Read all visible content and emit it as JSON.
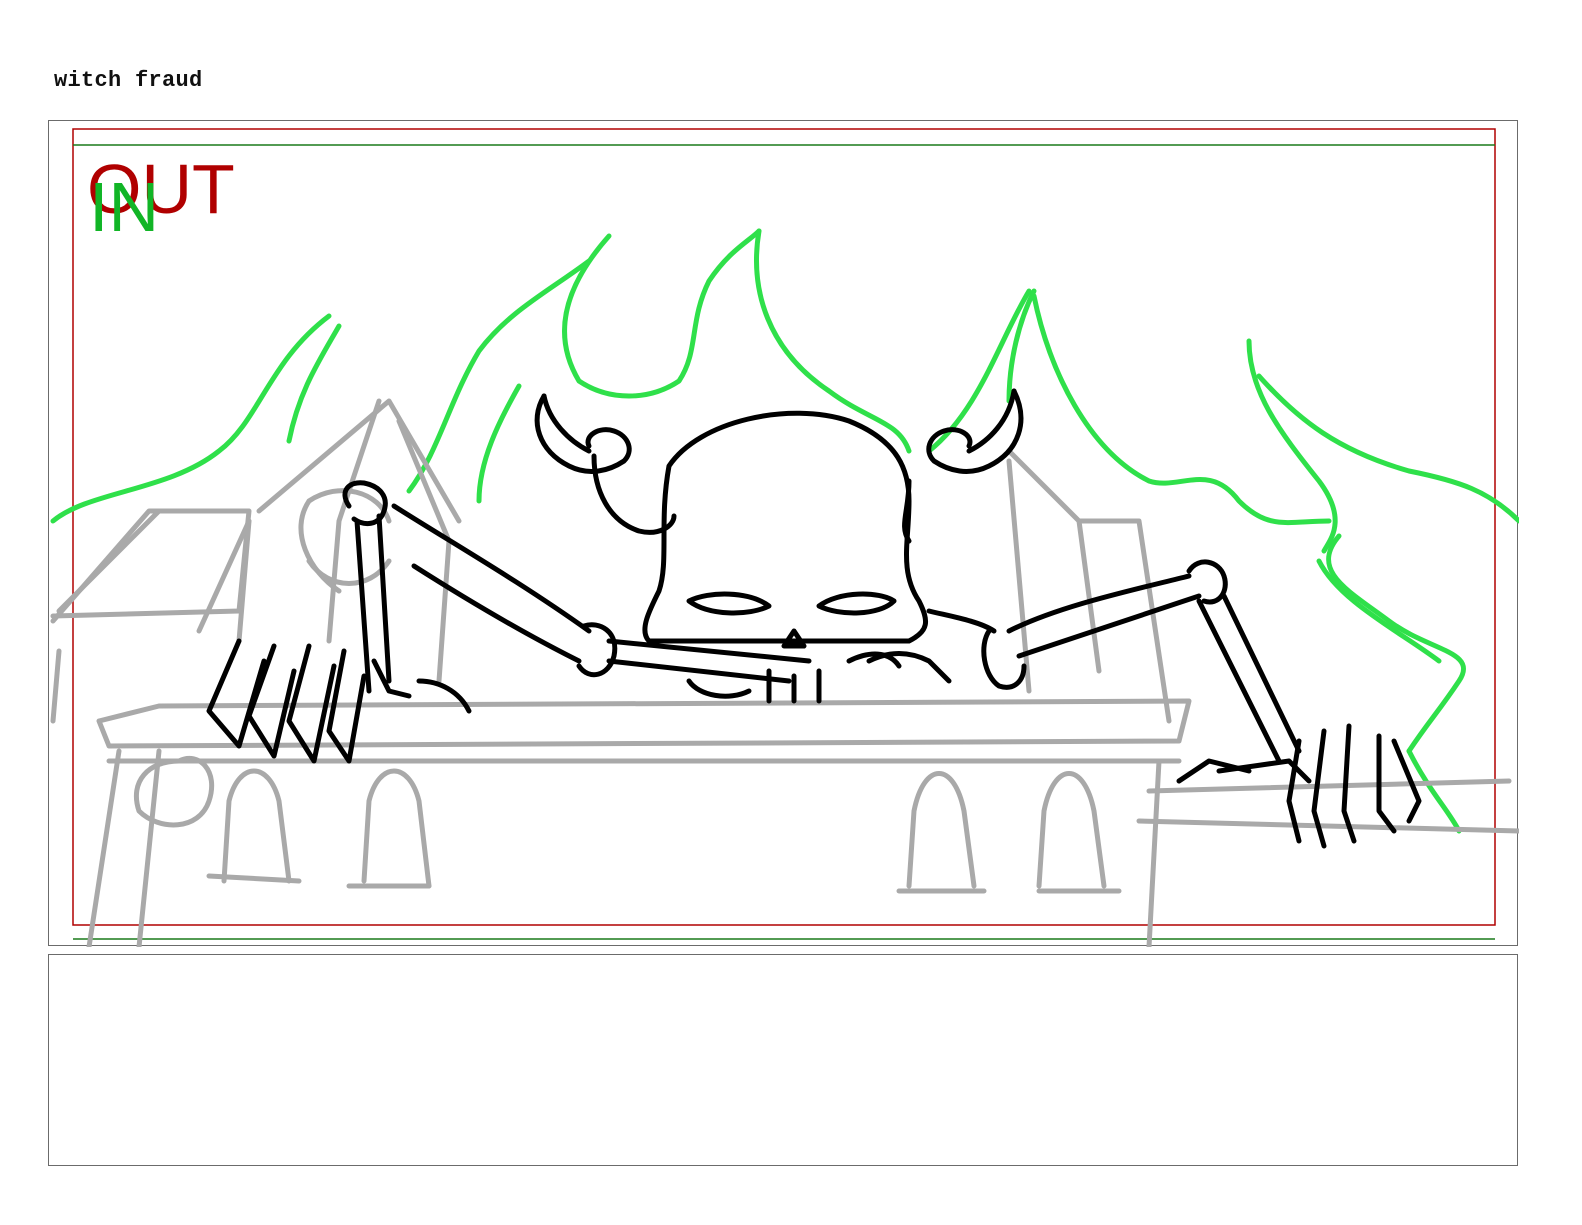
{
  "page": {
    "title": "witch fraud"
  },
  "panel": {
    "safe_area_labels": {
      "out": "OUT",
      "in": "IN"
    },
    "colors": {
      "out_frame": "#b00000",
      "in_frame": "#1a7a1a",
      "flames": "#2fe04a",
      "background_buildings": "#a9a9a9",
      "character_ink": "#000000"
    },
    "drawing": {
      "subject": "skeleton demon with horns",
      "background": "castle rooftops",
      "effect": "green flames"
    }
  },
  "notes": {
    "text": ""
  }
}
